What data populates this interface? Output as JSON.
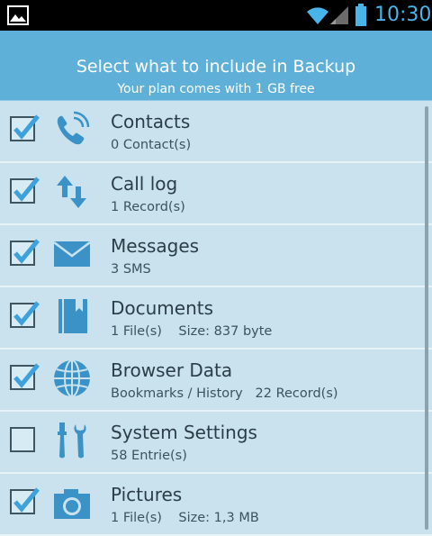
{
  "status_bar": {
    "time": "10:30",
    "icons": [
      "gallery-icon",
      "wifi-icon",
      "signal-icon",
      "battery-icon"
    ],
    "accent_color": "#49b4ea"
  },
  "header": {
    "title": "Select what to include in Backup",
    "subtitle": "Your plan comes with 1 GB free",
    "background": "#5eb0d9"
  },
  "items": [
    {
      "title": "Contacts",
      "detail": "0 Contact(s)",
      "checked": true,
      "icon": "phone-icon"
    },
    {
      "title": "Call log",
      "detail": "1 Record(s)",
      "checked": true,
      "icon": "updown-arrows-icon"
    },
    {
      "title": "Messages",
      "detail": "3 SMS",
      "checked": true,
      "icon": "envelope-icon"
    },
    {
      "title": "Documents",
      "detail": "1 File(s)    Size: 837 byte",
      "checked": true,
      "icon": "document-icon"
    },
    {
      "title": "Browser Data",
      "detail": "Bookmarks / History   22 Record(s)",
      "checked": true,
      "icon": "globe-icon"
    },
    {
      "title": "System Settings",
      "detail": "58 Entrie(s)",
      "checked": false,
      "icon": "tools-icon"
    },
    {
      "title": "Pictures",
      "detail": "1 File(s)    Size: 1,3 MB",
      "checked": true,
      "icon": "camera-icon"
    }
  ]
}
